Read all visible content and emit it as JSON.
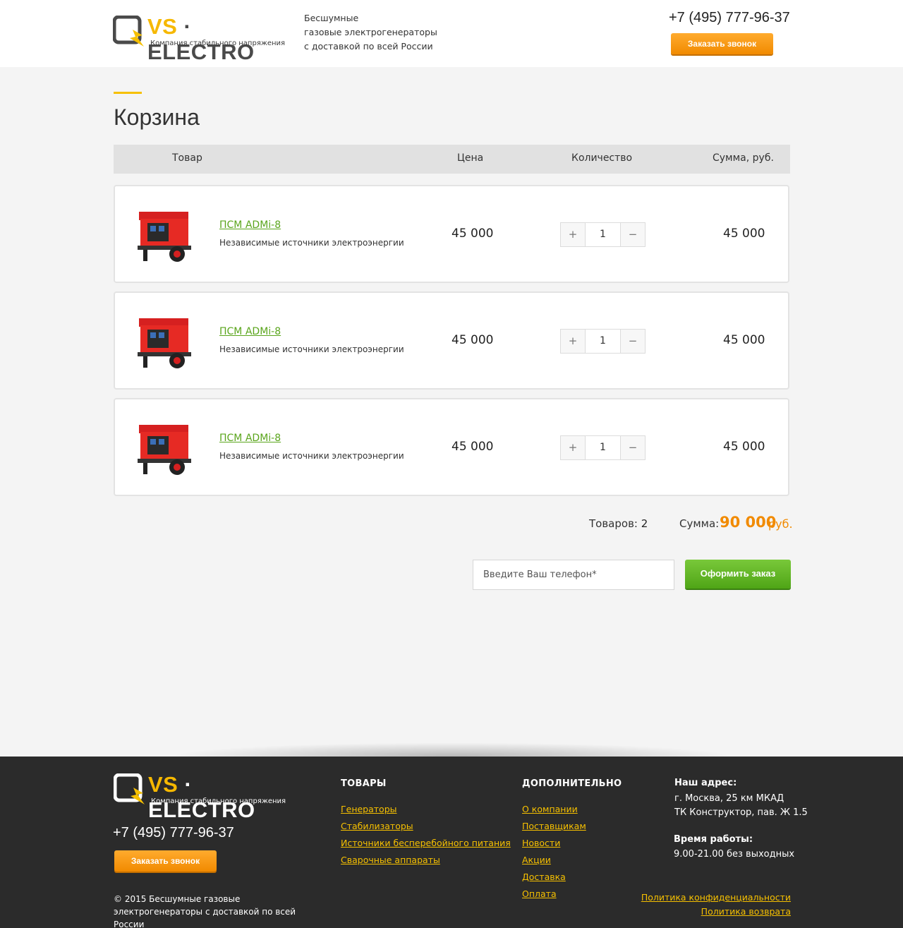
{
  "header": {
    "brand_vs": "VS",
    "brand_dot": "·",
    "brand_electro": "ELECTRO",
    "brand_tagline": "Компания стабильного напряжения",
    "tagline_line1": "Бесшумные",
    "tagline_line2": "газовые электрогенераторы",
    "tagline_line3": "с доставкой по всей России",
    "phone": "+7 (495) 777-96-37",
    "callback_label": "Заказать звонок"
  },
  "cart": {
    "title": "Корзина",
    "columns": {
      "product": "Товар",
      "price": "Цена",
      "quantity": "Количество",
      "sum": "Сумма, руб."
    },
    "items": [
      {
        "name": "ПСМ ADMi-8",
        "description": "Независимые источники электроэнергии",
        "price": "45 000",
        "quantity": "1",
        "sum": "45 000",
        "plus": "+",
        "minus": "−"
      },
      {
        "name": "ПСМ ADMi-8",
        "description": "Независимые источники электроэнергии",
        "price": "45 000",
        "quantity": "1",
        "sum": "45 000",
        "plus": "+",
        "minus": "−"
      },
      {
        "name": "ПСМ ADMi-8",
        "description": "Независимые источники электроэнергии",
        "price": "45 000",
        "quantity": "1",
        "sum": "45 000",
        "plus": "+",
        "minus": "−"
      }
    ],
    "totals": {
      "count_label": "Товаров:",
      "count_value": "2",
      "sum_label": "Сумма:",
      "sum_value": "90 000",
      "currency": "руб."
    },
    "order": {
      "phone_placeholder": "Введите Ваш телефон*",
      "submit_label": "Оформить заказ"
    }
  },
  "footer": {
    "phone": "+7 (495) 777-96-37",
    "callback_label": "Заказать звонок",
    "copyright_line1": "© 2015 Бесшумные газовые",
    "copyright_line2": "электрогенераторы с доставкой по всей России",
    "products_title": "ТОВАРЫ",
    "products_links": [
      "Генераторы",
      "Стабилизаторы",
      "Источники бесперебойного питания",
      "Сварочные аппараты"
    ],
    "extra_title": "ДОПОЛНИТЕЛЬНО",
    "extra_links": [
      "О компании",
      "Поставщикам",
      "Новости",
      "Акции",
      "Доставка",
      "Оплата"
    ],
    "address_title": "Наш адрес:",
    "address_line1": "г. Москва, 25 км МКАД",
    "address_line2": "ТК Конструктор, пав. Ж 1.5",
    "hours_title": "Время работы:",
    "hours_text": "9.00-21.00 без выходных",
    "privacy_policy": "Политика конфиденциальности",
    "return_policy": "Политика возврата"
  },
  "colors": {
    "accent_yellow": "#f6c000",
    "accent_orange": "#f18a00",
    "accent_green": "#5aa51c",
    "footer_bg": "#2b2b2b"
  }
}
